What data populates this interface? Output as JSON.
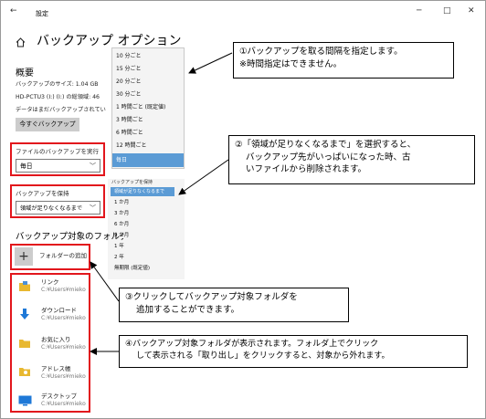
{
  "window": {
    "title": "設定",
    "back_glyph": "←",
    "minimize_glyph": "─",
    "maximize_glyph": "□",
    "close_glyph": "✕"
  },
  "page": {
    "home_icon": "home-icon",
    "title": "バックアップ オプション"
  },
  "overview": {
    "heading": "概要",
    "size_line": "バックアップのサイズ: 1.04 GB",
    "drive_line": "HD-PCTU3 (I:) (I:) の総領域: 46",
    "status_line": "データはまだバックアップされてい",
    "backup_now_label": "今すぐバックアップ"
  },
  "frequency": {
    "label": "ファイルのバックアップを実行",
    "value": "毎日",
    "options": [
      "10 分ごと",
      "15 分ごと",
      "20 分ごと",
      "30 分ごと",
      "1 時間ごと (既定値)",
      "3 時間ごと",
      "6 時間ごと",
      "12 時間ごと",
      "毎日"
    ],
    "selected_index": 8
  },
  "retention": {
    "label": "バックアップを保持",
    "value": "領域が足りなくなるまで",
    "popup_label": "バックアップを保持",
    "options": [
      "領域が足りなくなるまで",
      "1 か月",
      "3 か月",
      "6 か月",
      "9 か月",
      "1 年",
      "2 年",
      "無期限 (既定値)"
    ],
    "selected_index": 0
  },
  "folders": {
    "heading": "バックアップ対象のフォルダー",
    "add_label": "フォルダーの追加",
    "add_glyph": "+",
    "items": [
      {
        "name": "リンク",
        "path": "C:¥Users¥mieko",
        "icon": "links-folder-icon",
        "color": "#e8b830"
      },
      {
        "name": "ダウンロード",
        "path": "C:¥Users¥mieko",
        "icon": "download-icon",
        "color": "#1e78d7"
      },
      {
        "name": "お気に入り",
        "path": "C:¥Users¥mieko",
        "icon": "favorites-folder-icon",
        "color": "#e8b830"
      },
      {
        "name": "アドレス帳",
        "path": "C:¥Users¥mieko",
        "icon": "contacts-folder-icon",
        "color": "#e8b830"
      },
      {
        "name": "デスクトップ",
        "path": "C:¥Users¥mieko",
        "icon": "desktop-icon",
        "color": "#1e78d7"
      }
    ]
  },
  "callouts": {
    "c1": {
      "line1": "①バックアップを取る間隔を指定します。",
      "line2": "※時間指定はできません。"
    },
    "c2": {
      "line1": "②「領域が足りなくなるまで」を選択すると、",
      "line2": "バックアップ先がいっぱいになった時、古",
      "line3": "いファイルから削除されます。"
    },
    "c3": {
      "line1": "③クリックしてバックアップ対象フォルダを",
      "line2": "追加することができます。"
    },
    "c4": {
      "line1": "④バックアップ対象フォルダが表示されます。フォルダ上でクリック",
      "line2": "して表示される「取り出し」をクリックすると、対象から外れます。"
    }
  },
  "colors": {
    "accent_red": "#e2161c",
    "selection_blue": "#5b9bd5",
    "button_gray": "#cccccc"
  }
}
